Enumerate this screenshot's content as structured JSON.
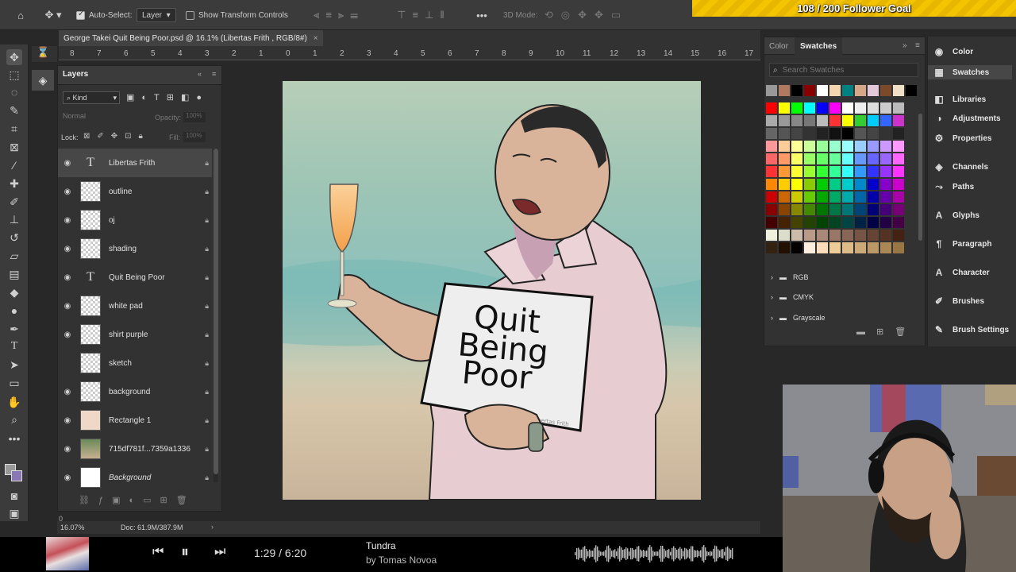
{
  "goal": {
    "text": "108 / 200 Follower Goal"
  },
  "options": {
    "auto_select_label": "Auto-Select:",
    "auto_select_value": "Layer",
    "transform_label": "Show Transform Controls",
    "mode_3d_label": "3D Mode:"
  },
  "document": {
    "tab_title": "George Takei Quit Being Poor.psd @ 16.1% (Libertas Frith , RGB/8#)",
    "ruler_numbers": [
      "8",
      "7",
      "6",
      "5",
      "4",
      "3",
      "2",
      "1",
      "0",
      "1",
      "2",
      "3",
      "4",
      "5",
      "6",
      "7",
      "8",
      "9",
      "10",
      "11",
      "12",
      "13",
      "14",
      "15",
      "16",
      "17"
    ],
    "zoom": "16.07%",
    "doc_size": "Doc: 61.9M/387.9M",
    "vertical_ruler_top": "0"
  },
  "layers_panel": {
    "title": "Layers",
    "filter_kind": "Kind",
    "blend_mode": "Normal",
    "opacity_label": "Opacity:",
    "opacity_value": "100%",
    "lock_label": "Lock:",
    "fill_label": "Fill:",
    "fill_value": "100%",
    "layers": [
      {
        "name": "Libertas Frith",
        "type": "text",
        "visible": true,
        "active": true
      },
      {
        "name": "outline",
        "type": "pixel",
        "visible": true
      },
      {
        "name": "oj",
        "type": "pixel",
        "visible": true
      },
      {
        "name": "shading",
        "type": "pixel",
        "visible": true
      },
      {
        "name": "Quit Being Poor",
        "type": "text",
        "visible": true
      },
      {
        "name": "white pad",
        "type": "pixel",
        "visible": true
      },
      {
        "name": "shirt purple",
        "type": "pixel",
        "visible": true
      },
      {
        "name": "sketch",
        "type": "pixel",
        "visible": false
      },
      {
        "name": "background",
        "type": "pixel",
        "visible": true
      },
      {
        "name": "Rectangle 1",
        "type": "solid",
        "visible": true
      },
      {
        "name": "715df781f...7359a1336",
        "type": "photo",
        "visible": true
      },
      {
        "name": "Background",
        "type": "white",
        "visible": true,
        "italic": true
      }
    ]
  },
  "artwork": {
    "sign_line1": "Quit",
    "sign_line2": "Being",
    "sign_line3": "Poor",
    "signature": "Libertas Frith"
  },
  "swatches_panel": {
    "tab_color": "Color",
    "tab_swatches": "Swatches",
    "search_placeholder": "Search Swatches",
    "folders": [
      "RGB",
      "CMYK",
      "Grayscale"
    ]
  },
  "right_panel": {
    "items": [
      "Color",
      "Swatches",
      "Libraries",
      "Adjustments",
      "Properties",
      "Channels",
      "Paths",
      "Glyphs",
      "Paragraph",
      "Character",
      "Brushes",
      "Brush Settings"
    ]
  },
  "media": {
    "time": "1:29 / 6:20",
    "track": "Tundra",
    "artist": "by Tomas Novoa"
  }
}
